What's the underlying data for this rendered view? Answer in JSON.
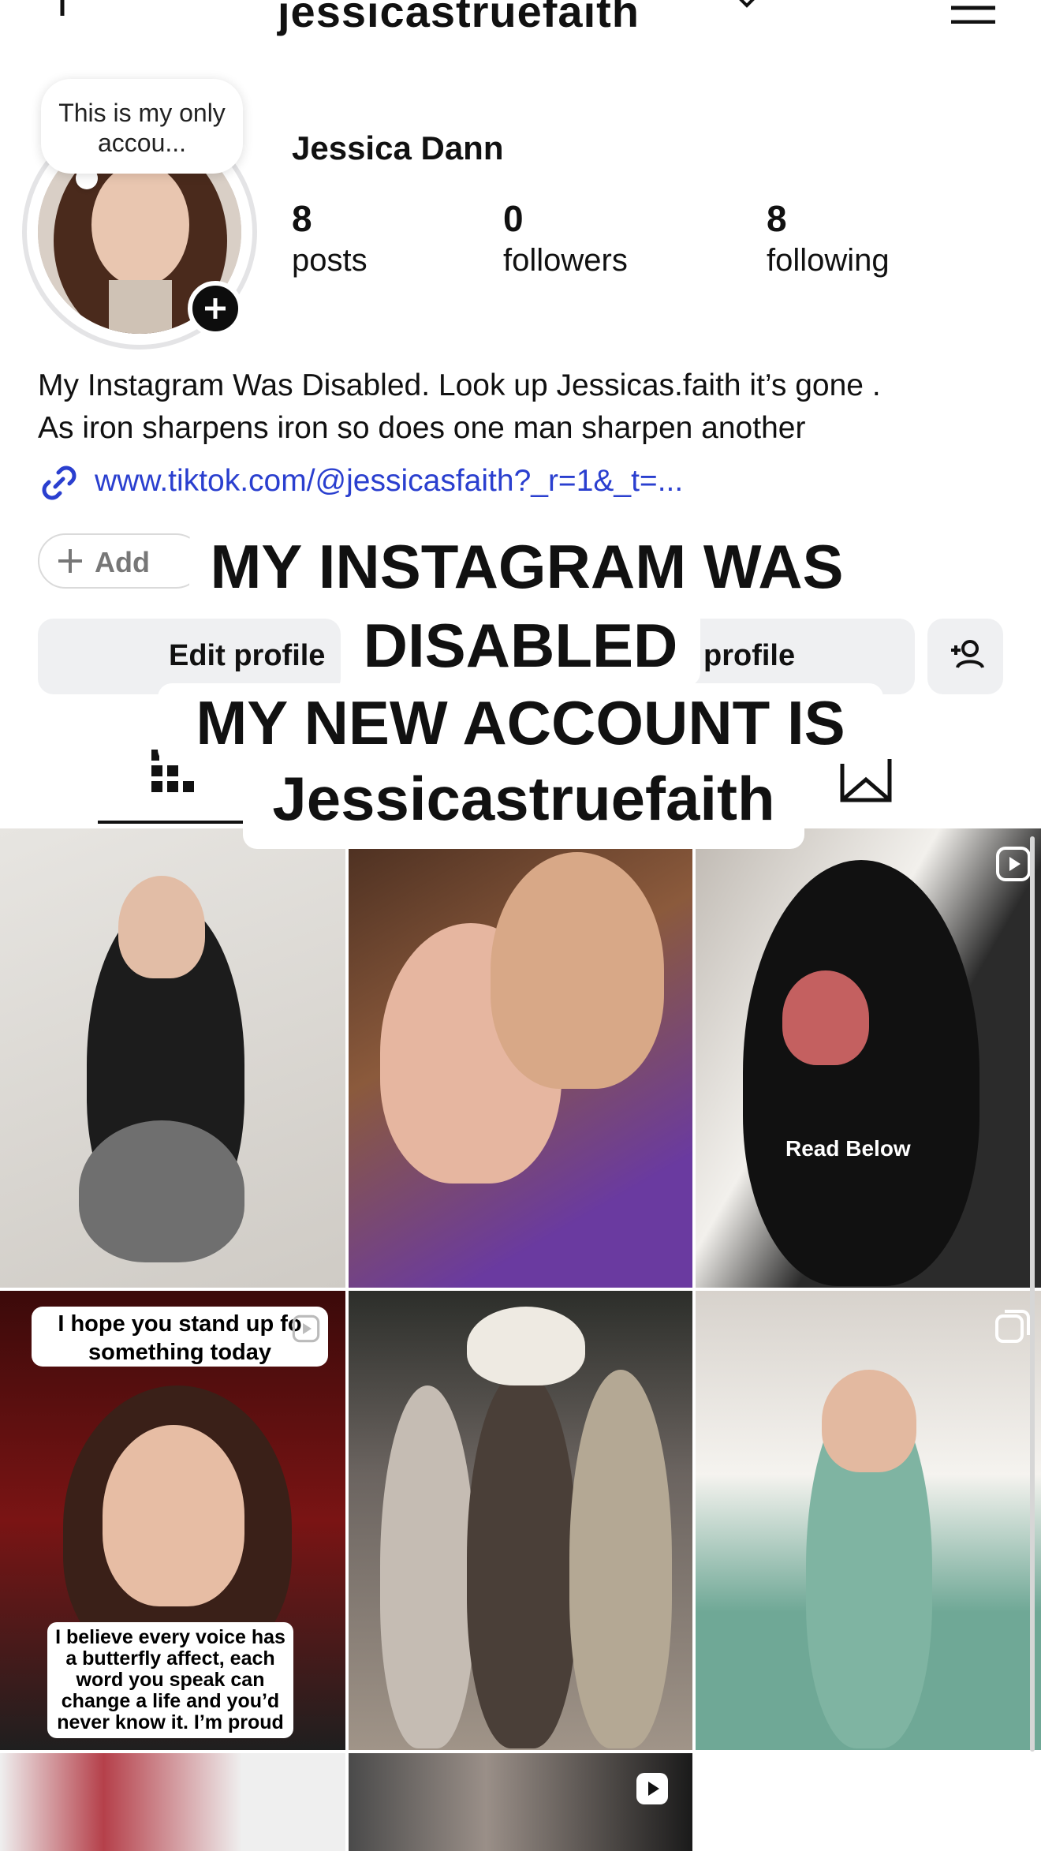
{
  "header": {
    "username": "jessicastruefaith",
    "icons": [
      "plus-icon",
      "chevron-down-icon",
      "menu-icon"
    ]
  },
  "profile": {
    "note": "This is my only accou...",
    "full_name": "Jessica Dann",
    "stats": [
      {
        "value": "8",
        "label": "posts"
      },
      {
        "value": "0",
        "label": "followers"
      },
      {
        "value": "8",
        "label": "following"
      }
    ],
    "bio_line1": "My Instagram Was Disabled. Look up Jessicas.faith it’s gone .",
    "bio_line2": "As iron sharpens iron so does one man sharpen another",
    "link": "www.tiktok.com/@jessicasfaith?_r=1&_t=...",
    "add_label": "Add"
  },
  "actions": {
    "edit_label": "Edit profile",
    "share_label": "profile"
  },
  "caption": {
    "line1": "MY INSTAGRAM WAS",
    "line2": "DISABLED",
    "line3": "MY NEW ACCOUNT IS",
    "line4": "Jessicastruefaith"
  },
  "posts": {
    "t3_text": "Read Below",
    "t4_top": "I hope you stand up fo something today",
    "t4_bottom": "I believe every voice has a butterfly affect, each word you speak can change a life and you’d never know it. I’m proud"
  }
}
